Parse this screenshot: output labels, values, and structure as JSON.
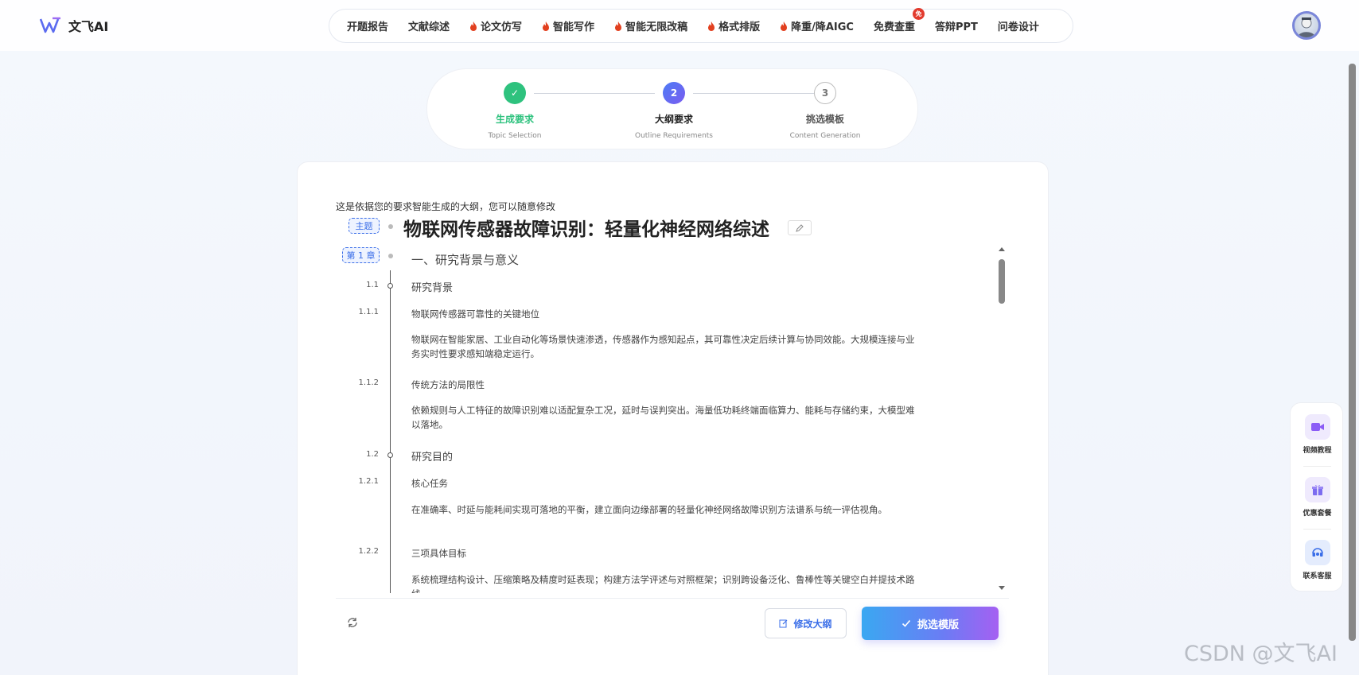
{
  "brand": {
    "name": "文飞AI"
  },
  "nav": {
    "items": [
      {
        "label": "开题报告",
        "hot": false
      },
      {
        "label": "文献综述",
        "hot": false
      },
      {
        "label": "论文仿写",
        "hot": true
      },
      {
        "label": "智能写作",
        "hot": true
      },
      {
        "label": "智能无限改稿",
        "hot": true
      },
      {
        "label": "格式排版",
        "hot": true
      },
      {
        "label": "降重/降AIGC",
        "hot": true
      },
      {
        "label": "免费查重",
        "hot": false
      },
      {
        "label": "答辩PPT",
        "hot": false
      },
      {
        "label": "问卷设计",
        "hot": false
      }
    ],
    "free_badge": "免"
  },
  "stepper": {
    "steps": [
      {
        "num": "✓",
        "title": "生成要求",
        "sub": "Topic Selection",
        "state": "done"
      },
      {
        "num": "2",
        "title": "大纲要求",
        "sub": "Outline Requirements",
        "state": "active"
      },
      {
        "num": "3",
        "title": "挑选模板",
        "sub": "Content Generation",
        "state": "todo"
      }
    ]
  },
  "outline": {
    "intro": "这是依据您的要求智能生成的大纲，您可以随意修改",
    "topic_tag": "主题",
    "title": "物联网传感器故障识别：轻量化神经网络综述",
    "chapter_tag": "第 1 章",
    "chapter_title": "一、研究背景与意义",
    "entries": [
      {
        "num": "1.1",
        "kind": "sec",
        "text": "研究背景"
      },
      {
        "num": "1.1.1",
        "kind": "sub",
        "text": "物联网传感器可靠性的关键地位"
      },
      {
        "num": "",
        "kind": "para",
        "text": "物联网在智能家居、工业自动化等场景快速渗透，传感器作为感知起点，其可靠性决定后续计算与协同效能。大规模连接与业务实时性要求感知端稳定运行。"
      },
      {
        "num": "1.1.2",
        "kind": "sub",
        "text": "传统方法的局限性"
      },
      {
        "num": "",
        "kind": "para",
        "text": "依赖规则与人工特征的故障识别难以适配复杂工况，延时与误判突出。海量低功耗终端面临算力、能耗与存储约束，大模型难以落地。"
      },
      {
        "num": "1.2",
        "kind": "sec",
        "text": "研究目的"
      },
      {
        "num": "1.2.1",
        "kind": "sub",
        "text": "核心任务"
      },
      {
        "num": "",
        "kind": "para",
        "text": "在准确率、时延与能耗间实现可落地的平衡，建立面向边缘部署的轻量化神经网络故障识别方法谱系与统一评估视角。"
      },
      {
        "num": "1.2.2",
        "kind": "sub",
        "text": "三项具体目标"
      },
      {
        "num": "",
        "kind": "para",
        "text": "系统梳理结构设计、压缩策略及精度时延表现；构建方法学评述与对照框架；识别跨设备泛化、鲁棒性等关键空白并提技术路线。"
      }
    ]
  },
  "actions": {
    "edit_outline": "修改大纲",
    "choose_template": "挑选模版"
  },
  "side_panel": {
    "items": [
      {
        "label": "视频教程",
        "icon": "video-icon"
      },
      {
        "label": "优惠套餐",
        "icon": "gift-icon"
      },
      {
        "label": "联系客服",
        "icon": "headset-icon"
      }
    ]
  },
  "watermark": "CSDN @文飞AI",
  "colors": {
    "accent": "#3a6ee8",
    "done": "#2ec27e",
    "hot": "#e2401f"
  }
}
